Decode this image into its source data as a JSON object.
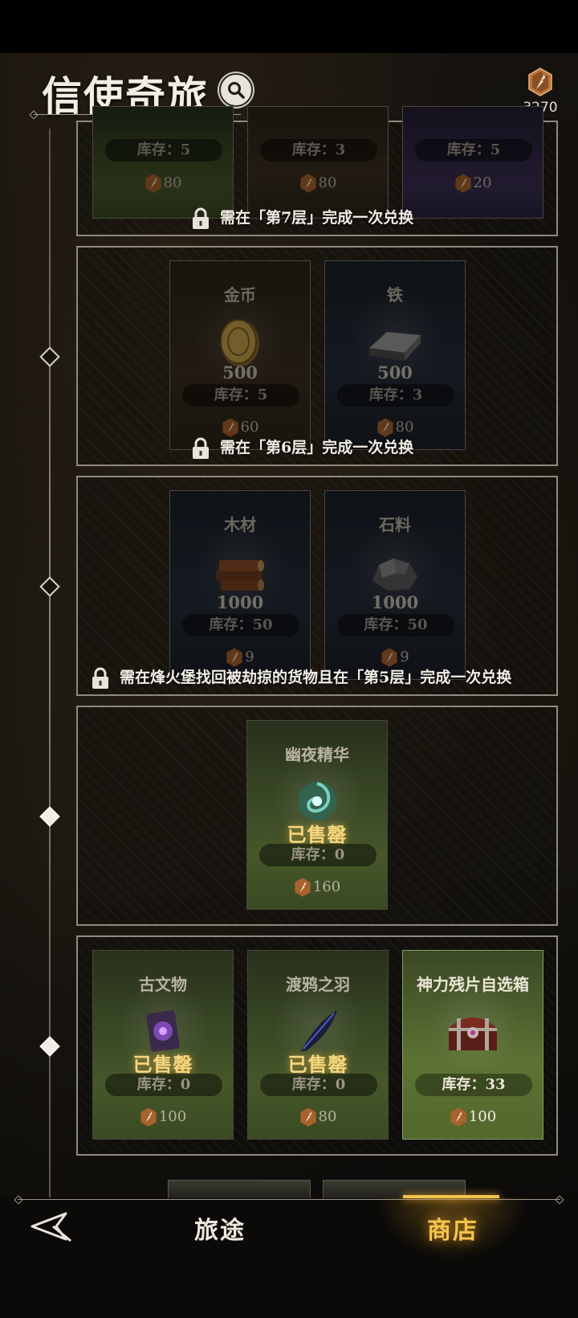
{
  "header": {
    "title": "信使奇旅",
    "currency_value": "3270"
  },
  "tiers": [
    {
      "items": [
        {
          "stock": "库存：5",
          "price": "80",
          "theme": "green"
        },
        {
          "stock": "库存：3",
          "price": "80",
          "theme": "brown"
        },
        {
          "stock": "库存：5",
          "price": "20",
          "theme": "purple"
        }
      ],
      "lock_text": "需在「第7层」完成一次兑换"
    },
    {
      "items": [
        {
          "name": "金币",
          "quantity": "500",
          "stock": "库存：5",
          "price": "60",
          "icon": "gold-coin-icon"
        },
        {
          "name": "铁",
          "quantity": "500",
          "stock": "库存：3",
          "price": "80",
          "icon": "iron-ingot-icon"
        }
      ],
      "lock_text": "需在「第6层」完成一次兑换"
    },
    {
      "items": [
        {
          "name": "木材",
          "quantity": "1000",
          "stock": "库存：50",
          "price": "9",
          "icon": "wood-logs-icon"
        },
        {
          "name": "石料",
          "quantity": "1000",
          "stock": "库存：50",
          "price": "9",
          "icon": "stone-icon"
        }
      ],
      "lock_text": "需在烽火堡找回被劫掠的货物且在「第5层」完成一次兑换"
    },
    {
      "items": [
        {
          "name": "幽夜精华",
          "status": "已售罄",
          "stock": "库存：0",
          "price": "160",
          "icon": "night-essence-icon"
        }
      ]
    },
    {
      "items": [
        {
          "name": "古文物",
          "status": "已售罄",
          "stock": "库存：0",
          "price": "100",
          "icon": "relic-icon"
        },
        {
          "name": "渡鸦之羽",
          "status": "已售罄",
          "stock": "库存：0",
          "price": "80",
          "icon": "raven-feather-icon"
        },
        {
          "name": "神力残片自选箱",
          "stock": "库存：33",
          "price": "100",
          "icon": "treasure-chest-icon"
        }
      ]
    }
  ],
  "nav": {
    "journey": "旅途",
    "shop": "商店"
  },
  "colors": {
    "accent": "#f3c44e",
    "sold_out": "#f6d680"
  }
}
